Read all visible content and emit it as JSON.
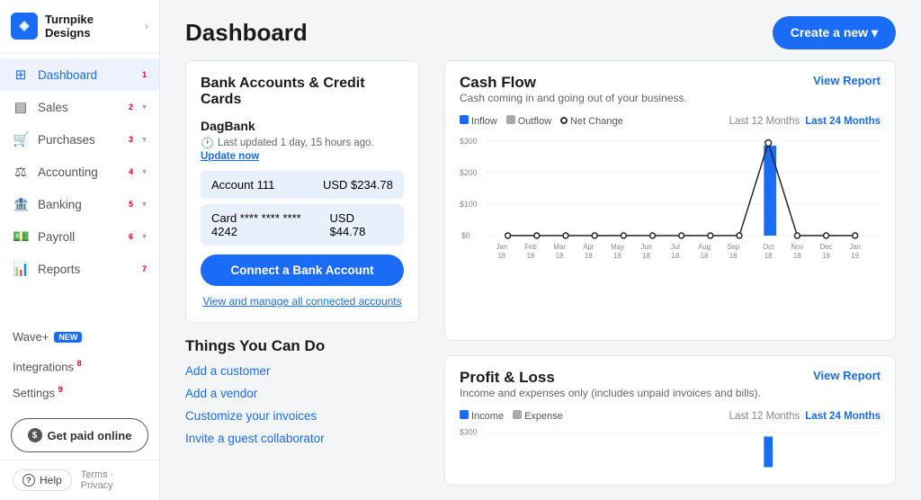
{
  "app": {
    "company_name": "Turnpike Designs",
    "logo_text": "W"
  },
  "sidebar": {
    "nav_items": [
      {
        "id": "dashboard",
        "label": "Dashboard",
        "icon": "⊞",
        "num": "1",
        "active": true
      },
      {
        "id": "sales",
        "label": "Sales",
        "icon": "▤",
        "num": "2",
        "has_chevron": true
      },
      {
        "id": "purchases",
        "label": "Purchases",
        "icon": "🛒",
        "num": "3",
        "has_chevron": true
      },
      {
        "id": "accounting",
        "label": "Accounting",
        "icon": "⚖",
        "num": "4",
        "has_chevron": true
      },
      {
        "id": "banking",
        "label": "Banking",
        "icon": "🏦",
        "num": "5",
        "has_chevron": true
      },
      {
        "id": "payroll",
        "label": "Payroll",
        "icon": "💵",
        "num": "6",
        "has_chevron": true
      },
      {
        "id": "reports",
        "label": "Reports",
        "icon": "📊",
        "num": "7",
        "has_chevron": false
      }
    ],
    "wave_plus": "Wave+",
    "wave_badge": "NEW",
    "integrations": "Integrations",
    "integrations_num": "8",
    "settings": "Settings",
    "settings_num": "9",
    "get_paid": "Get paid online",
    "help": "Help",
    "terms": "Terms",
    "privacy": "Privacy"
  },
  "header": {
    "title": "Dashboard",
    "create_btn": "Create a new ▾"
  },
  "bank_section": {
    "title": "Bank Accounts & Credit Cards",
    "bank_name": "DagBank",
    "last_updated": "Last updated 1 day, 15 hours ago.",
    "update_now": "Update now",
    "account_name": "Account 111",
    "account_amount": "USD $234.78",
    "card_name": "Card **** **** **** 4242",
    "card_amount": "USD $44.78",
    "connect_btn": "Connect a Bank Account",
    "manage_link": "View and manage all connected accounts"
  },
  "things_section": {
    "title": "Things You Can Do",
    "links": [
      "Add a customer",
      "Add a vendor",
      "Customize your invoices",
      "Invite a guest collaborator"
    ]
  },
  "cashflow": {
    "title": "Cash Flow",
    "subtitle": "Cash coming in and going out of your business.",
    "view_report": "View Report",
    "legend": {
      "inflow": "Inflow",
      "outflow": "Outflow",
      "net_change": "Net Change"
    },
    "time_12": "Last 12 Months",
    "time_24": "Last 24 Months",
    "y_labels": [
      "$300",
      "$200",
      "$100",
      "$0"
    ],
    "x_labels": [
      "Jan\n18",
      "Feb\n18",
      "Mar\n18",
      "Apr\n18",
      "May\n18",
      "Jun\n18",
      "Jul\n18",
      "Aug\n18",
      "Sep\n18",
      "Oct\n18",
      "Nov\n18",
      "Dec\n18",
      "Jan\n19"
    ]
  },
  "profit_loss": {
    "title": "Profit & Loss",
    "subtitle": "Income and expenses only (includes unpaid invoices and bills).",
    "view_report": "View Report",
    "legend": {
      "income": "Income",
      "expense": "Expense"
    },
    "time_12": "Last 12 Months",
    "time_24": "Last 24 Months",
    "y_label_top": "$300"
  }
}
